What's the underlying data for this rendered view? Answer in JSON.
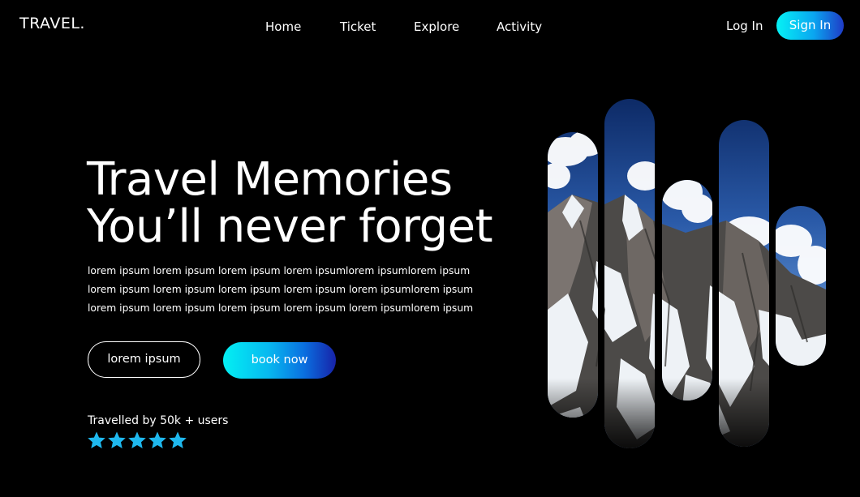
{
  "brand": {
    "logo": "TRAVEL."
  },
  "nav": {
    "items": [
      "Home",
      "Ticket",
      "Explore",
      "Activity"
    ]
  },
  "auth": {
    "login_label": "Log In",
    "signin_label": "Sign In"
  },
  "hero": {
    "title_line1": "Travel Memories",
    "title_line2": "You’ll never forget",
    "body_lines": [
      "lorem ipsum lorem ipsum lorem ipsum lorem ipsumlorem ipsumlorem ipsum",
      "lorem ipsum lorem ipsum lorem ipsum  lorem ipsum  lorem ipsumlorem ipsum",
      "lorem ipsum lorem ipsum lorem ipsum  lorem ipsum  lorem ipsumlorem ipsum"
    ],
    "secondary_button": "lorem ipsum",
    "primary_button": "book now"
  },
  "social_proof": {
    "text": "Travelled by 50k + users",
    "rating": 5,
    "star_color": "#1fb8ee"
  },
  "colors": {
    "accent_cyan": "#05f2f5",
    "accent_blue": "#1f3bc6",
    "background": "#000000"
  },
  "gallery": {
    "image": "snowy-mountain-peaks",
    "strips": 5
  }
}
